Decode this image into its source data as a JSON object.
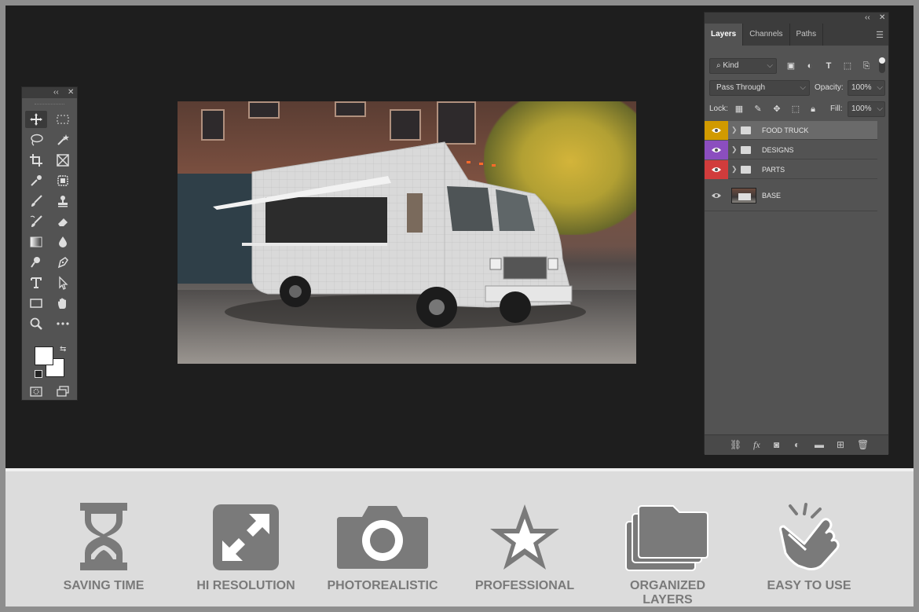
{
  "layers_panel": {
    "tabs": [
      {
        "label": "Layers",
        "active": true
      },
      {
        "label": "Channels",
        "active": false
      },
      {
        "label": "Paths",
        "active": false
      }
    ],
    "filter": {
      "label": "Kind"
    },
    "blend_mode": {
      "value": "Pass Through"
    },
    "opacity": {
      "label": "Opacity:",
      "value": "100%"
    },
    "lock": {
      "label": "Lock:"
    },
    "fill": {
      "label": "Fill:",
      "value": "100%"
    },
    "layers": [
      {
        "name": "FOOD TRUCK",
        "color": "#d19a00",
        "type": "group",
        "selected": true
      },
      {
        "name": "DESIGNS",
        "color": "#8b4ebf",
        "type": "group",
        "selected": false
      },
      {
        "name": "PARTS",
        "color": "#d13c3c",
        "type": "group",
        "selected": false
      },
      {
        "name": "BASE",
        "color": "",
        "type": "image",
        "selected": false
      }
    ]
  },
  "features": [
    {
      "label": "SAVING TIME",
      "icon": "hourglass-icon"
    },
    {
      "label": "HI RESOLUTION",
      "icon": "expand-arrows-icon"
    },
    {
      "label": "PHOTOREALISTIC",
      "icon": "camera-icon"
    },
    {
      "label": "PROFESSIONAL",
      "icon": "star-icon"
    },
    {
      "label": "ORGANIZED LAYERS",
      "icon": "stacked-folders-icon"
    },
    {
      "label": "EASY TO USE",
      "icon": "pointing-hand-icon"
    }
  ],
  "colors": {
    "feature_icon": "#7a7a7a",
    "workspace": "#1e1e1e",
    "panel": "#535353"
  }
}
